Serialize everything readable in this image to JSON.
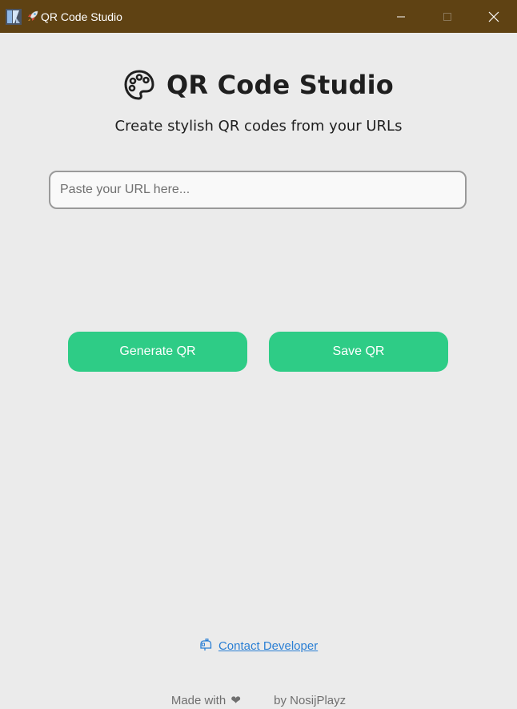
{
  "window": {
    "title": "QR Code Studio",
    "title_icon": "rocket-icon",
    "app_icon": "app-logo-icon",
    "controls": [
      "minimize-icon",
      "maximize-icon",
      "close-icon"
    ],
    "titlebar_color": "#5f4213"
  },
  "header": {
    "icon": "palette-icon",
    "title": "QR Code Studio",
    "subtitle": "Create stylish QR codes from your URLs"
  },
  "url_input": {
    "placeholder": "Paste your URL here...",
    "value": ""
  },
  "buttons": {
    "generate": "Generate QR",
    "save": "Save QR",
    "color": "#2ecc86"
  },
  "contact": {
    "icon": "mailbox-icon",
    "label": "Contact Developer",
    "color": "#2a7fd4"
  },
  "footer": {
    "made_with": "Made with",
    "heart": "❤",
    "by": "by NosijPlayz"
  }
}
